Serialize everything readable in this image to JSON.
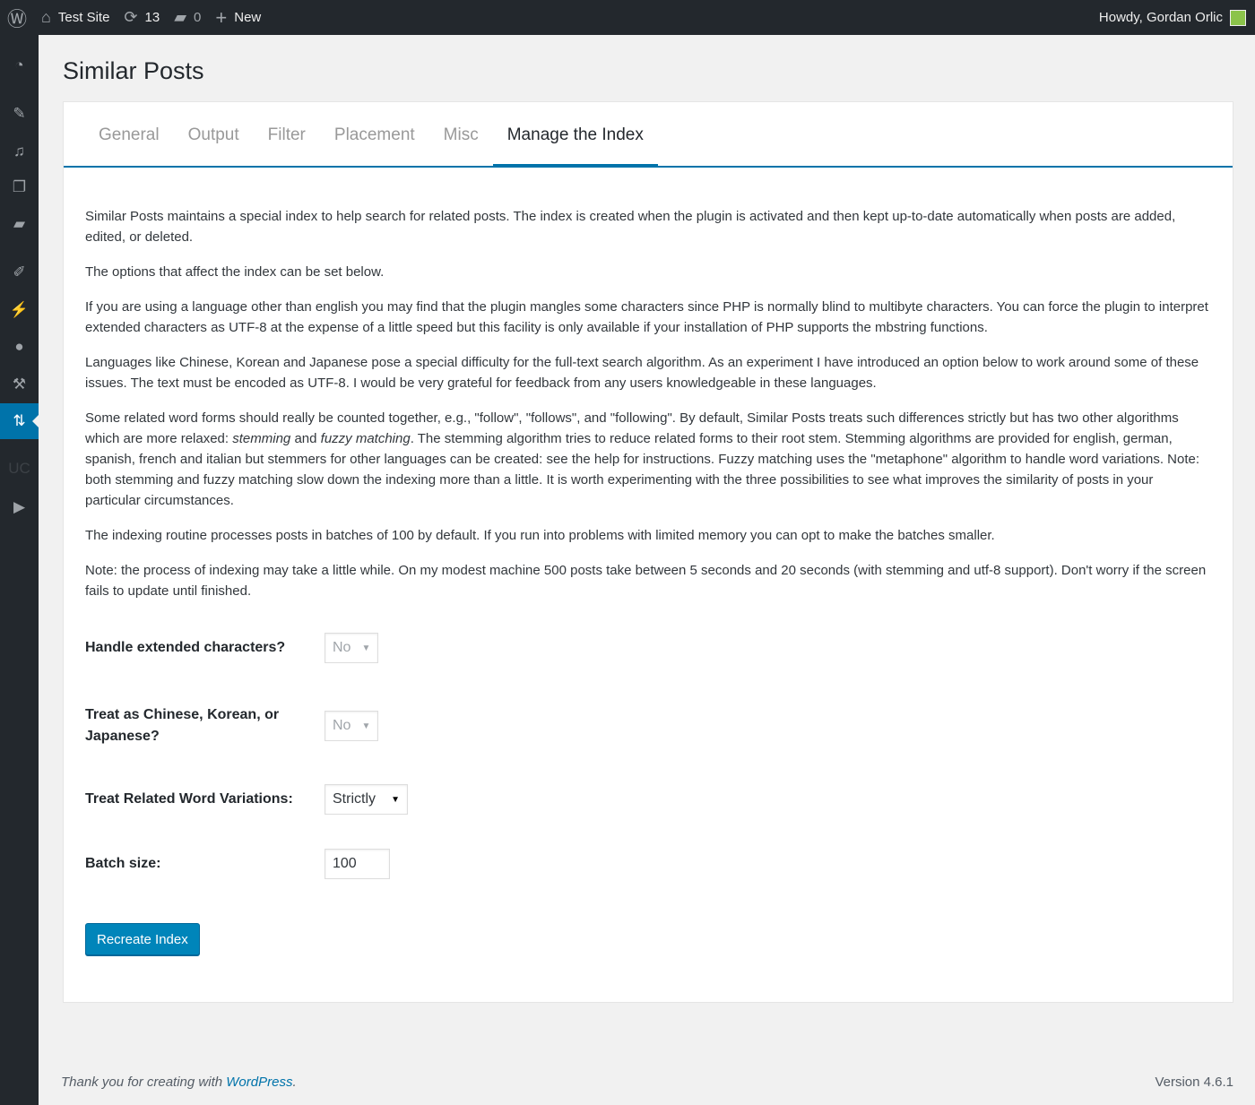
{
  "topbar": {
    "site": "Test Site",
    "updates": "13",
    "comments": "0",
    "new": "New",
    "howdy": "Howdy, Gordan Orlic"
  },
  "sidebar": {
    "uc": "UC"
  },
  "page": {
    "title": "Similar Posts"
  },
  "tabs": [
    "General",
    "Output",
    "Filter",
    "Placement",
    "Misc",
    "Manage the Index"
  ],
  "content": {
    "p1": "Similar Posts maintains a special index to help search for related posts. The index is created when the plugin is activated and then kept up-to-date automatically when posts are added, edited, or deleted.",
    "p2": "The options that affect the index can be set below.",
    "p3": "If you are using a language other than english you may find that the plugin mangles some characters since PHP is normally blind to multibyte characters. You can force the plugin to interpret extended characters as UTF-8 at the expense of a little speed but this facility is only available if your installation of PHP supports the mbstring functions.",
    "p4": "Languages like Chinese, Korean and Japanese pose a special difficulty for the full-text search algorithm. As an experiment I have introduced an option below to work around some of these issues. The text must be encoded as UTF-8. I would be very grateful for feedback from any users knowledgeable in these languages.",
    "p5a": "Some related word forms should really be counted together, e.g., \"follow\", \"follows\", and \"following\". By default, Similar Posts treats such differences strictly but has two other algorithms which are more relaxed: ",
    "p5em1": "stemming",
    "p5b": " and ",
    "p5em2": "fuzzy matching",
    "p5c": ". The stemming algorithm tries to reduce related forms to their root stem. Stemming algorithms are provided for english, german, spanish, french and italian but stemmers for other languages can be created: see the help for instructions. Fuzzy matching uses the \"metaphone\" algorithm to handle word variations. Note: both stemming and fuzzy matching slow down the indexing more than a little. It is worth experimenting with the three possibilities to see what improves the similarity of posts in your particular circumstances.",
    "p6": "The indexing routine processes posts in batches of 100 by default. If you run into problems with limited memory you can opt to make the batches smaller.",
    "p7": "Note: the process of indexing may take a little while. On my modest machine 500 posts take between 5 seconds and 20 seconds (with stemming and utf-8 support). Don't worry if the screen fails to update until finished."
  },
  "form": {
    "extended_label": "Handle extended characters?",
    "extended_value": "No",
    "cjk_label": "Treat as Chinese, Korean, or Japanese?",
    "cjk_value": "No",
    "variations_label": "Treat Related Word Variations:",
    "variations_value": "Strictly",
    "batch_label": "Batch size:",
    "batch_value": "100",
    "button": "Recreate Index"
  },
  "footer": {
    "thanks": "Thank you for creating with ",
    "link": "WordPress",
    "period": ".",
    "version": "Version 4.6.1"
  },
  "colors": {
    "accent": "#0073aa",
    "adminbar": "#23282d",
    "button": "#0085ba"
  }
}
